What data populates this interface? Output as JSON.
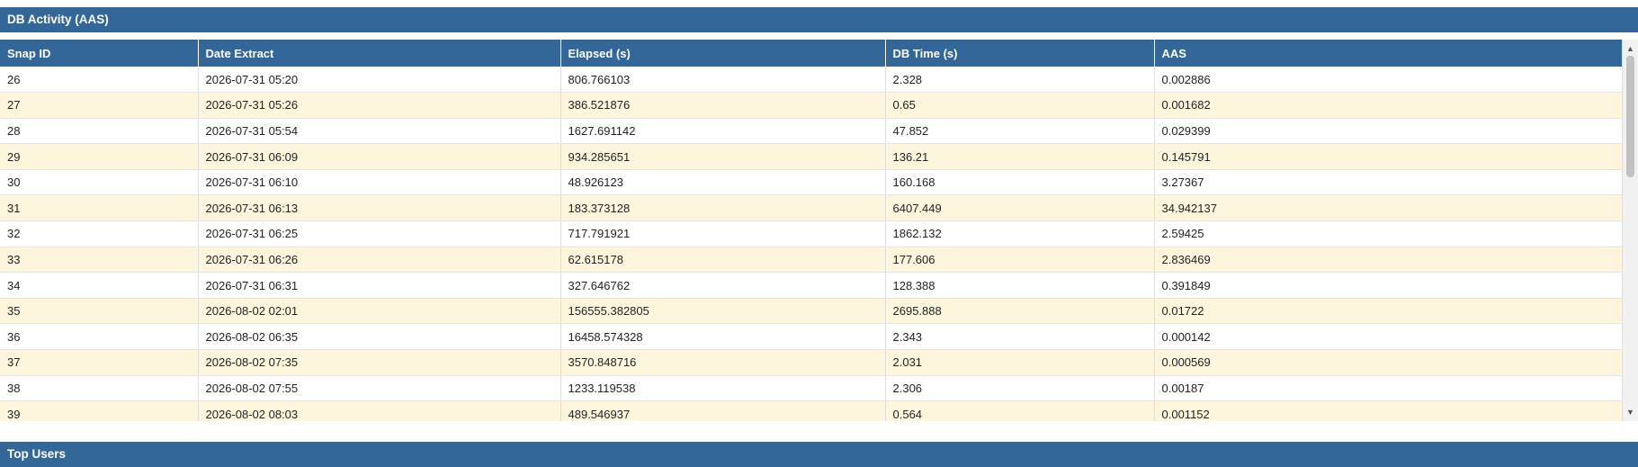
{
  "sections": {
    "db_activity_title": "DB Activity (AAS)",
    "top_users_title": "Top Users"
  },
  "table": {
    "columns": [
      "Snap ID",
      "Date Extract",
      "Elapsed (s)",
      "DB Time (s)",
      "AAS"
    ],
    "rows": [
      [
        "26",
        "2026-07-31 05:20",
        "806.766103",
        "2.328",
        "0.002886"
      ],
      [
        "27",
        "2026-07-31 05:26",
        "386.521876",
        "0.65",
        "0.001682"
      ],
      [
        "28",
        "2026-07-31 05:54",
        "1627.691142",
        "47.852",
        "0.029399"
      ],
      [
        "29",
        "2026-07-31 06:09",
        "934.285651",
        "136.21",
        "0.145791"
      ],
      [
        "30",
        "2026-07-31 06:10",
        "48.926123",
        "160.168",
        "3.27367"
      ],
      [
        "31",
        "2026-07-31 06:13",
        "183.373128",
        "6407.449",
        "34.942137"
      ],
      [
        "32",
        "2026-07-31 06:25",
        "717.791921",
        "1862.132",
        "2.59425"
      ],
      [
        "33",
        "2026-07-31 06:26",
        "62.615178",
        "177.606",
        "2.836469"
      ],
      [
        "34",
        "2026-07-31 06:31",
        "327.646762",
        "128.388",
        "0.391849"
      ],
      [
        "35",
        "2026-08-02 02:01",
        "156555.382805",
        "2695.888",
        "0.01722"
      ],
      [
        "36",
        "2026-08-02 06:35",
        "16458.574328",
        "2.343",
        "0.000142"
      ],
      [
        "37",
        "2026-08-02 07:35",
        "3570.848716",
        "2.031",
        "0.000569"
      ],
      [
        "38",
        "2026-08-02 07:55",
        "1233.119538",
        "2.306",
        "0.00187"
      ],
      [
        "39",
        "2026-08-02 08:03",
        "489.546937",
        "0.564",
        "0.001152"
      ]
    ]
  },
  "colors": {
    "header_blue": "#336699",
    "row_alt": "#fdf6dd"
  },
  "icons": {
    "scroll_up": "scroll-up-arrow-icon",
    "scroll_down": "scroll-down-arrow-icon"
  }
}
